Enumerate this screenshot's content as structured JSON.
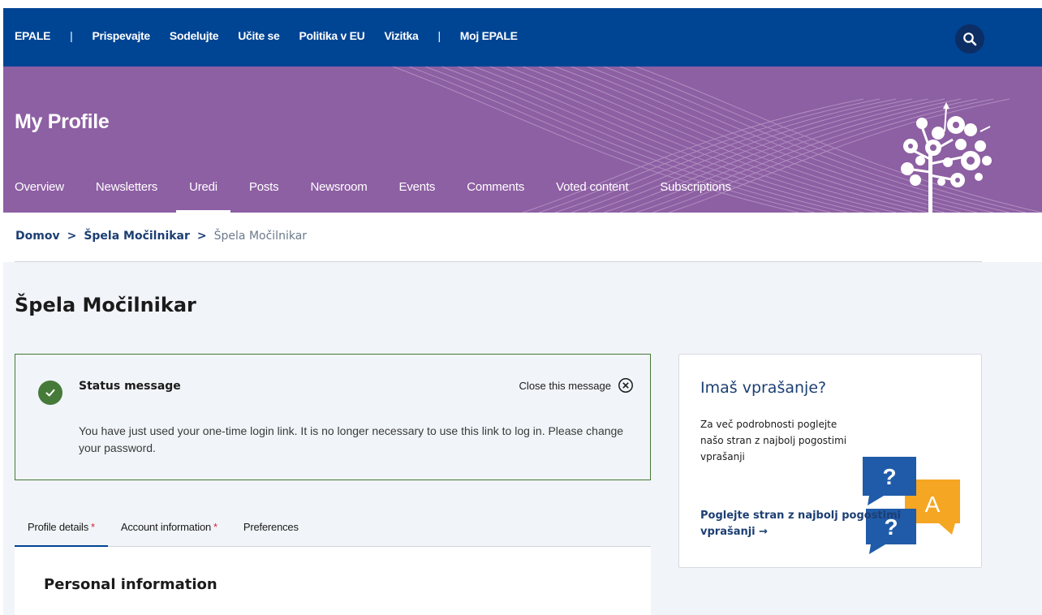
{
  "top_nav": {
    "brand": "EPALE",
    "separator": "|",
    "items": [
      "Prispevajte",
      "Sodelujte",
      "Učite se",
      "Politika v EU",
      "Vizitka"
    ],
    "my_epale": "Moj EPALE"
  },
  "icons": {
    "search": "search-icon",
    "check": "check-icon",
    "close": "close-circle-icon",
    "tree": "epale-tree-logo",
    "faq": "question-answer-bubbles"
  },
  "colors": {
    "top_bar": "#004494",
    "hero": "#8d5fa3",
    "success": "#467a39",
    "link": "#1c3f73",
    "required": "#d4243a"
  },
  "hero": {
    "title": "My Profile",
    "tabs": [
      "Overview",
      "Newsletters",
      "Uredi",
      "Posts",
      "Newsroom",
      "Events",
      "Comments",
      "Voted content",
      "Subscriptions"
    ],
    "active_tab": "Uredi"
  },
  "breadcrumb": {
    "items": [
      "Domov",
      "Špela Močilnikar"
    ],
    "current": "Špela Močilnikar",
    "separator": ">"
  },
  "page": {
    "title": "Špela Močilnikar"
  },
  "status": {
    "title": "Status message",
    "close_label": "Close this message",
    "text": "You have just used your one-time login link. It is no longer necessary to use this link to log in. Please change your password."
  },
  "form_tabs": [
    {
      "label": "Profile details",
      "required": "*"
    },
    {
      "label": "Account information",
      "required": "*"
    },
    {
      "label": "Preferences",
      "required": ""
    }
  ],
  "form": {
    "section_title": "Personal information"
  },
  "faq": {
    "title": "Imaš vprašanje?",
    "text": "Za več podrobnosti poglejte našo stran z najbolj pogostimi vprašanji",
    "link": "Poglejte stran z najbolj pogostimi vprašanji →"
  }
}
